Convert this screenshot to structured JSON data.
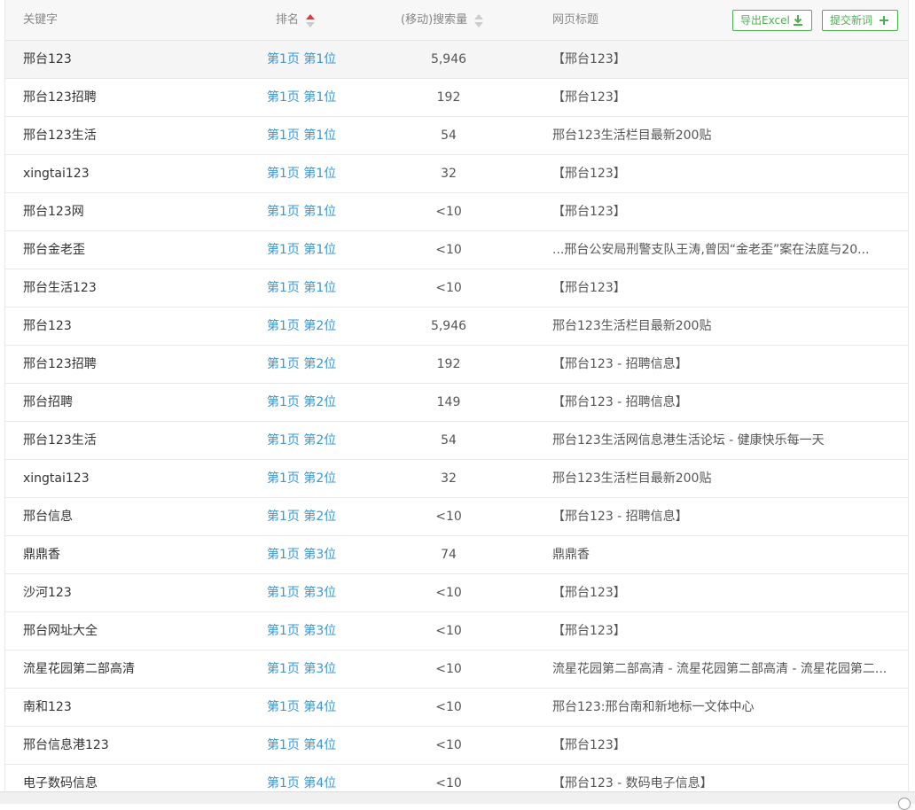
{
  "header": {
    "keyword": "关键字",
    "rank": "排名",
    "volume": "(移动)搜索量",
    "title": "网页标题",
    "export_label": "导出Excel",
    "submit_label": "提交新词"
  },
  "colors": {
    "accent_green": "#4caf50",
    "link_blue": "#3b97d3",
    "sort_active": "#e4393c"
  },
  "rows": [
    {
      "keyword": "邢台123",
      "rank": "第1页 第1位",
      "volume": "5,946",
      "title": "【邢台123】"
    },
    {
      "keyword": "邢台123招聘",
      "rank": "第1页 第1位",
      "volume": "192",
      "title": "【邢台123】"
    },
    {
      "keyword": "邢台123生活",
      "rank": "第1页 第1位",
      "volume": "54",
      "title": "邢台123生活栏目最新200贴"
    },
    {
      "keyword": "xingtai123",
      "rank": "第1页 第1位",
      "volume": "32",
      "title": "【邢台123】"
    },
    {
      "keyword": "邢台123网",
      "rank": "第1页 第1位",
      "volume": "<10",
      "title": "【邢台123】"
    },
    {
      "keyword": "邢台金老歪",
      "rank": "第1页 第1位",
      "volume": "<10",
      "title": "...邢台公安局刑警支队王涛,曾因“金老歪”案在法庭与20..."
    },
    {
      "keyword": "邢台生活123",
      "rank": "第1页 第1位",
      "volume": "<10",
      "title": "【邢台123】"
    },
    {
      "keyword": "邢台123",
      "rank": "第1页 第2位",
      "volume": "5,946",
      "title": "邢台123生活栏目最新200贴"
    },
    {
      "keyword": "邢台123招聘",
      "rank": "第1页 第2位",
      "volume": "192",
      "title": "【邢台123 - 招聘信息】"
    },
    {
      "keyword": "邢台招聘",
      "rank": "第1页 第2位",
      "volume": "149",
      "title": "【邢台123 - 招聘信息】"
    },
    {
      "keyword": "邢台123生活",
      "rank": "第1页 第2位",
      "volume": "54",
      "title": "邢台123生活网信息港生活论坛 - 健康快乐每一天"
    },
    {
      "keyword": "xingtai123",
      "rank": "第1页 第2位",
      "volume": "32",
      "title": "邢台123生活栏目最新200贴"
    },
    {
      "keyword": "邢台信息",
      "rank": "第1页 第2位",
      "volume": "<10",
      "title": "【邢台123 - 招聘信息】"
    },
    {
      "keyword": "鼎鼎香",
      "rank": "第1页 第3位",
      "volume": "74",
      "title": "鼎鼎香"
    },
    {
      "keyword": "沙河123",
      "rank": "第1页 第3位",
      "volume": "<10",
      "title": "【邢台123】"
    },
    {
      "keyword": "邢台网址大全",
      "rank": "第1页 第3位",
      "volume": "<10",
      "title": "【邢台123】"
    },
    {
      "keyword": "流星花园第二部高清",
      "rank": "第1页 第3位",
      "volume": "<10",
      "title": "流星花园第二部高清 - 流星花园第二部高清 - 流星花园第二..."
    },
    {
      "keyword": "南和123",
      "rank": "第1页 第4位",
      "volume": "<10",
      "title": "邢台123:邢台南和新地标一文体中心"
    },
    {
      "keyword": "邢台信息港123",
      "rank": "第1页 第4位",
      "volume": "<10",
      "title": "【邢台123】"
    },
    {
      "keyword": "电子数码信息",
      "rank": "第1页 第4位",
      "volume": "<10",
      "title": "【邢台123 - 数码电子信息】"
    }
  ]
}
